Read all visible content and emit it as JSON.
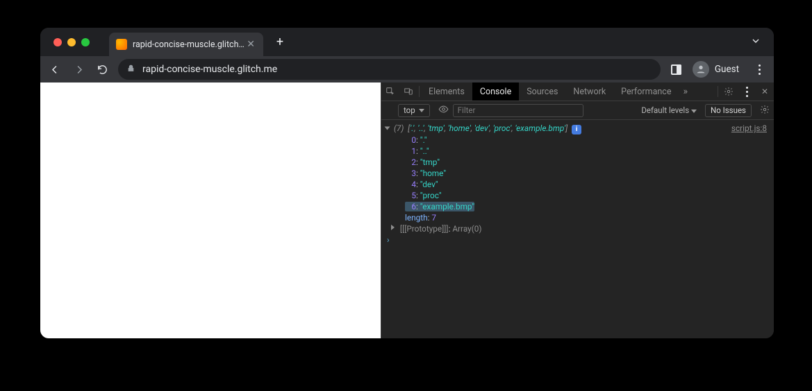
{
  "browser": {
    "tab_title": "rapid-concise-muscle.glitch.m",
    "url_display": "rapid-concise-muscle.glitch.me",
    "guest_label": "Guest"
  },
  "devtools": {
    "tabs": [
      "Elements",
      "Console",
      "Sources",
      "Network",
      "Performance"
    ],
    "active_tab": "Console",
    "context_label": "top",
    "filter_placeholder": "Filter",
    "levels_label": "Default levels",
    "issues_label": "No Issues",
    "source_link": "script.js:8"
  },
  "console": {
    "summary_count": "(7)",
    "summary_items": [
      "'.'",
      "'..'",
      "'tmp'",
      "'home'",
      "'dev'",
      "'proc'",
      "'example.bmp'"
    ],
    "entries": [
      {
        "index": "0",
        "value": "\".\""
      },
      {
        "index": "1",
        "value": "\"..\""
      },
      {
        "index": "2",
        "value": "\"tmp\""
      },
      {
        "index": "3",
        "value": "\"home\""
      },
      {
        "index": "4",
        "value": "\"dev\""
      },
      {
        "index": "5",
        "value": "\"proc\""
      },
      {
        "index": "6",
        "value": "\"example.bmp\"",
        "highlighted": true
      }
    ],
    "length_key": "length",
    "length_value": "7",
    "proto_label": "[[Prototype]]",
    "proto_value": "Array(0)"
  }
}
